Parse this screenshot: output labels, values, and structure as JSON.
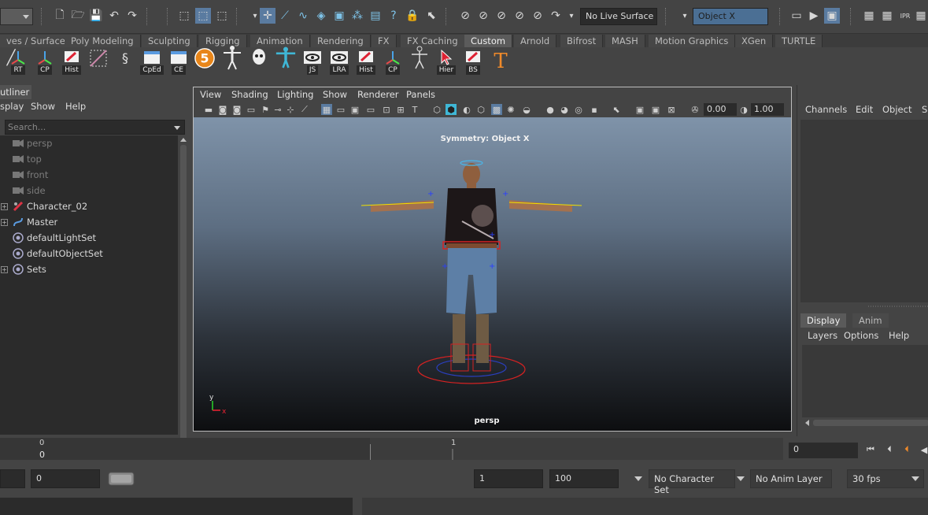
{
  "status_line": {
    "live_surface": "No Live Surface",
    "symmetry": "Object X"
  },
  "shelf": {
    "tabs": [
      "ves / Surfaces",
      "Poly Modeling",
      "Sculpting",
      "Rigging",
      "Animation",
      "Rendering",
      "FX",
      "FX Caching",
      "Custom",
      "Arnold",
      "Bifrost",
      "MASH",
      "Motion Graphics",
      "XGen",
      "TURTLE"
    ],
    "active_tab": "Custom",
    "icons": [
      {
        "name": "rt-joint-icon",
        "label": "RT"
      },
      {
        "name": "cp-joint-icon",
        "label": "CP"
      },
      {
        "name": "hist-pencil-icon",
        "label": "Hist"
      },
      {
        "name": "lattice-icon",
        "label": ""
      },
      {
        "name": "python-icon",
        "label": ""
      },
      {
        "name": "cped-window-icon",
        "label": "CpEd"
      },
      {
        "name": "ce-window-icon",
        "label": "CE"
      },
      {
        "name": "five-badge-icon",
        "label": "5"
      },
      {
        "name": "humanik-figure-icon",
        "label": ""
      },
      {
        "name": "skull-icon",
        "label": ""
      },
      {
        "name": "tpose-figure-icon",
        "label": ""
      },
      {
        "name": "js-eye-icon",
        "label": "JS"
      },
      {
        "name": "lra-eye-icon",
        "label": "LRA"
      },
      {
        "name": "hist2-pencil-icon",
        "label": "Hist"
      },
      {
        "name": "cp2-joint-icon",
        "label": "CP"
      },
      {
        "name": "skeleton-figure-icon",
        "label": ""
      },
      {
        "name": "hier-cursor-icon",
        "label": "Hier"
      },
      {
        "name": "bs-pencil-icon",
        "label": "BS"
      },
      {
        "name": "text-t-icon",
        "label": "T"
      }
    ]
  },
  "outliner": {
    "title": "utliner",
    "menu": [
      "splay",
      "Show",
      "Help"
    ],
    "search_placeholder": "Search...",
    "items": [
      {
        "label": "persp",
        "type": "camera",
        "dim": true,
        "expandable": false
      },
      {
        "label": "top",
        "type": "camera",
        "dim": true,
        "expandable": false
      },
      {
        "label": "front",
        "type": "camera",
        "dim": true,
        "expandable": false
      },
      {
        "label": "side",
        "type": "camera",
        "dim": true,
        "expandable": false
      },
      {
        "label": "Character_02",
        "type": "character",
        "dim": false,
        "expandable": true
      },
      {
        "label": "Master",
        "type": "curve",
        "dim": false,
        "expandable": true
      },
      {
        "label": "defaultLightSet",
        "type": "set",
        "dim": false,
        "expandable": false
      },
      {
        "label": "defaultObjectSet",
        "type": "set",
        "dim": false,
        "expandable": false
      },
      {
        "label": "Sets",
        "type": "set",
        "dim": false,
        "expandable": true
      }
    ]
  },
  "viewport": {
    "menu": [
      "View",
      "Shading",
      "Lighting",
      "Show",
      "Renderer",
      "Panels"
    ],
    "exposure": "0.00",
    "gamma": "1.00",
    "symmetry_label": "Symmetry: Object X",
    "camera_label": "persp",
    "axis_y": "y",
    "axis_x": "x"
  },
  "channel_box": {
    "menu": [
      "Channels",
      "Edit",
      "Object",
      "Sh"
    ]
  },
  "layer_editor": {
    "tabs": [
      "Display",
      "Anim"
    ],
    "active_tab": "Display",
    "menu": [
      "Layers",
      "Options",
      "Help"
    ]
  },
  "time_slider": {
    "tick_0_top": "0",
    "tick_0_bottom": "0",
    "tick_1": "1",
    "current_frame": "0"
  },
  "range_slider": {
    "start_left": "",
    "start": "0",
    "range_start": "1",
    "range_end": "100",
    "character_set": "No Character Set",
    "anim_layer": "No Anim Layer",
    "fps": "30 fps"
  },
  "colors": {
    "accent_blue": "#4b6f94",
    "viewport_top": "#7f93a9",
    "viewport_bottom": "#0d0e10",
    "cyan_active": "#3fb7d6"
  }
}
